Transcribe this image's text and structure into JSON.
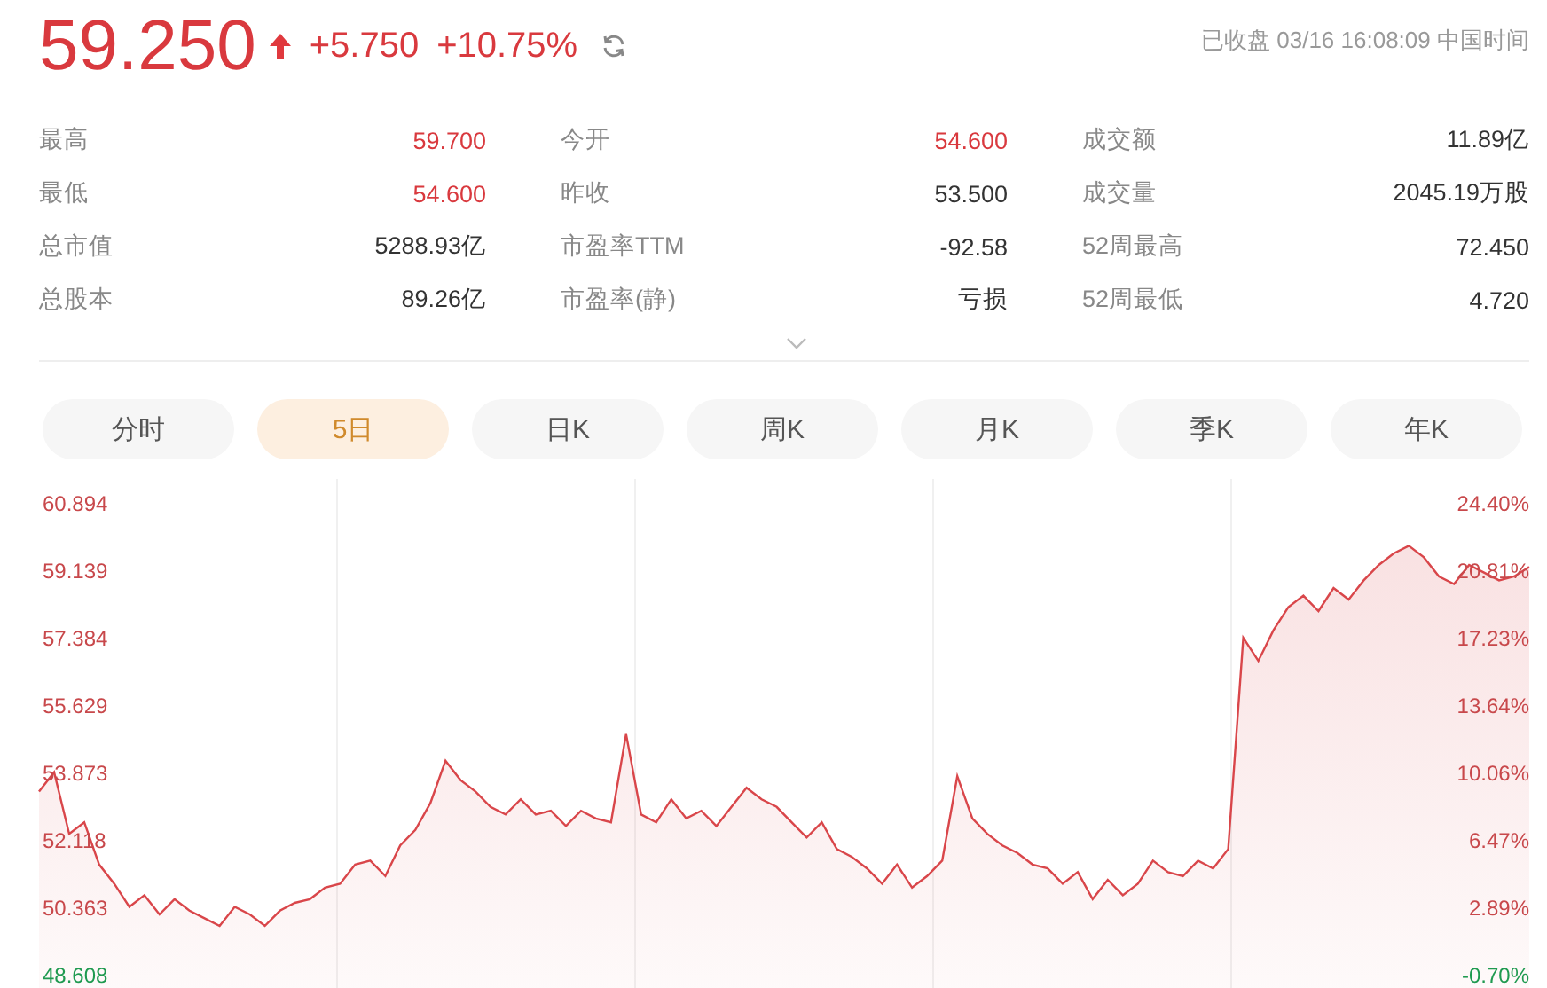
{
  "quote": {
    "price": "59.250",
    "rising": true,
    "change": "+5.750",
    "change_pct": "+10.75%",
    "status": "已收盘 03/16 16:08:09 中国时间"
  },
  "stats": [
    {
      "label": "最高",
      "value": "59.700",
      "highlighted": true
    },
    {
      "label": "今开",
      "value": "54.600",
      "highlighted": true
    },
    {
      "label": "成交额",
      "value": "11.89亿",
      "highlighted": false
    },
    {
      "label": "最低",
      "value": "54.600",
      "highlighted": true
    },
    {
      "label": "昨收",
      "value": "53.500",
      "highlighted": false
    },
    {
      "label": "成交量",
      "value": "2045.19万股",
      "highlighted": false
    },
    {
      "label": "总市值",
      "value": "5288.93亿",
      "highlighted": false
    },
    {
      "label": "市盈率TTM",
      "value": "-92.58",
      "highlighted": false
    },
    {
      "label": "52周最高",
      "value": "72.450",
      "highlighted": false
    },
    {
      "label": "总股本",
      "value": "89.26亿",
      "highlighted": false
    },
    {
      "label": "市盈率(静)",
      "value": "亏损",
      "highlighted": false
    },
    {
      "label": "52周最低",
      "value": "4.720",
      "highlighted": false
    }
  ],
  "tabs": [
    {
      "label": "分时",
      "selected": false
    },
    {
      "label": "5日",
      "selected": true
    },
    {
      "label": "日K",
      "selected": false
    },
    {
      "label": "周K",
      "selected": false
    },
    {
      "label": "月K",
      "selected": false
    },
    {
      "label": "季K",
      "selected": false
    },
    {
      "label": "年K",
      "selected": false
    }
  ],
  "chart": {
    "percent_axis": [
      {
        "label": "24.40%",
        "negative": false
      },
      {
        "label": "20.81%",
        "negative": false
      },
      {
        "label": "17.23%",
        "negative": false
      },
      {
        "label": "13.64%",
        "negative": false
      },
      {
        "label": "10.06%",
        "negative": false
      },
      {
        "label": "6.47%",
        "negative": false
      },
      {
        "label": "2.89%",
        "negative": false
      },
      {
        "label": "-0.70%",
        "negative": true
      }
    ],
    "chart_data": {
      "type": "area",
      "ylim": [
        48.608,
        60.894
      ],
      "yticks": [
        60.894,
        59.139,
        57.384,
        55.629,
        53.873,
        52.118,
        50.363,
        48.608
      ],
      "series": [
        {
          "color": "#d9464a",
          "values": [
            53.4,
            53.9,
            52.3,
            52.6,
            51.5,
            51.0,
            50.4,
            50.7,
            50.2,
            50.6,
            50.3,
            50.1,
            49.9,
            50.4,
            50.2,
            49.9,
            50.3,
            50.5,
            50.6,
            50.9,
            51.0,
            51.5,
            51.6,
            51.2,
            52.0,
            52.4,
            53.1,
            54.2,
            53.7,
            53.4,
            53.0,
            52.8,
            53.2,
            52.8,
            52.9,
            52.5,
            52.9,
            52.7,
            52.6,
            54.9,
            52.8,
            52.6,
            53.2,
            52.7,
            52.9,
            52.5,
            53.0,
            53.5,
            53.2,
            53.0,
            52.6,
            52.2,
            52.6,
            51.9,
            51.7,
            51.4,
            51.0,
            51.5,
            50.9,
            51.2,
            51.6,
            53.8,
            52.7,
            52.3,
            52.0,
            51.8,
            51.5,
            51.4,
            51.0,
            51.3,
            50.6,
            51.1,
            50.7,
            51.0,
            51.6,
            51.3,
            51.2,
            51.6,
            51.4,
            51.9,
            57.4,
            56.8,
            57.6,
            58.2,
            58.5,
            58.1,
            58.7,
            58.4,
            58.9,
            59.3,
            59.6,
            59.8,
            59.5,
            59.0,
            58.8,
            59.3,
            59.1,
            58.9,
            59.0,
            59.25
          ]
        }
      ]
    }
  }
}
